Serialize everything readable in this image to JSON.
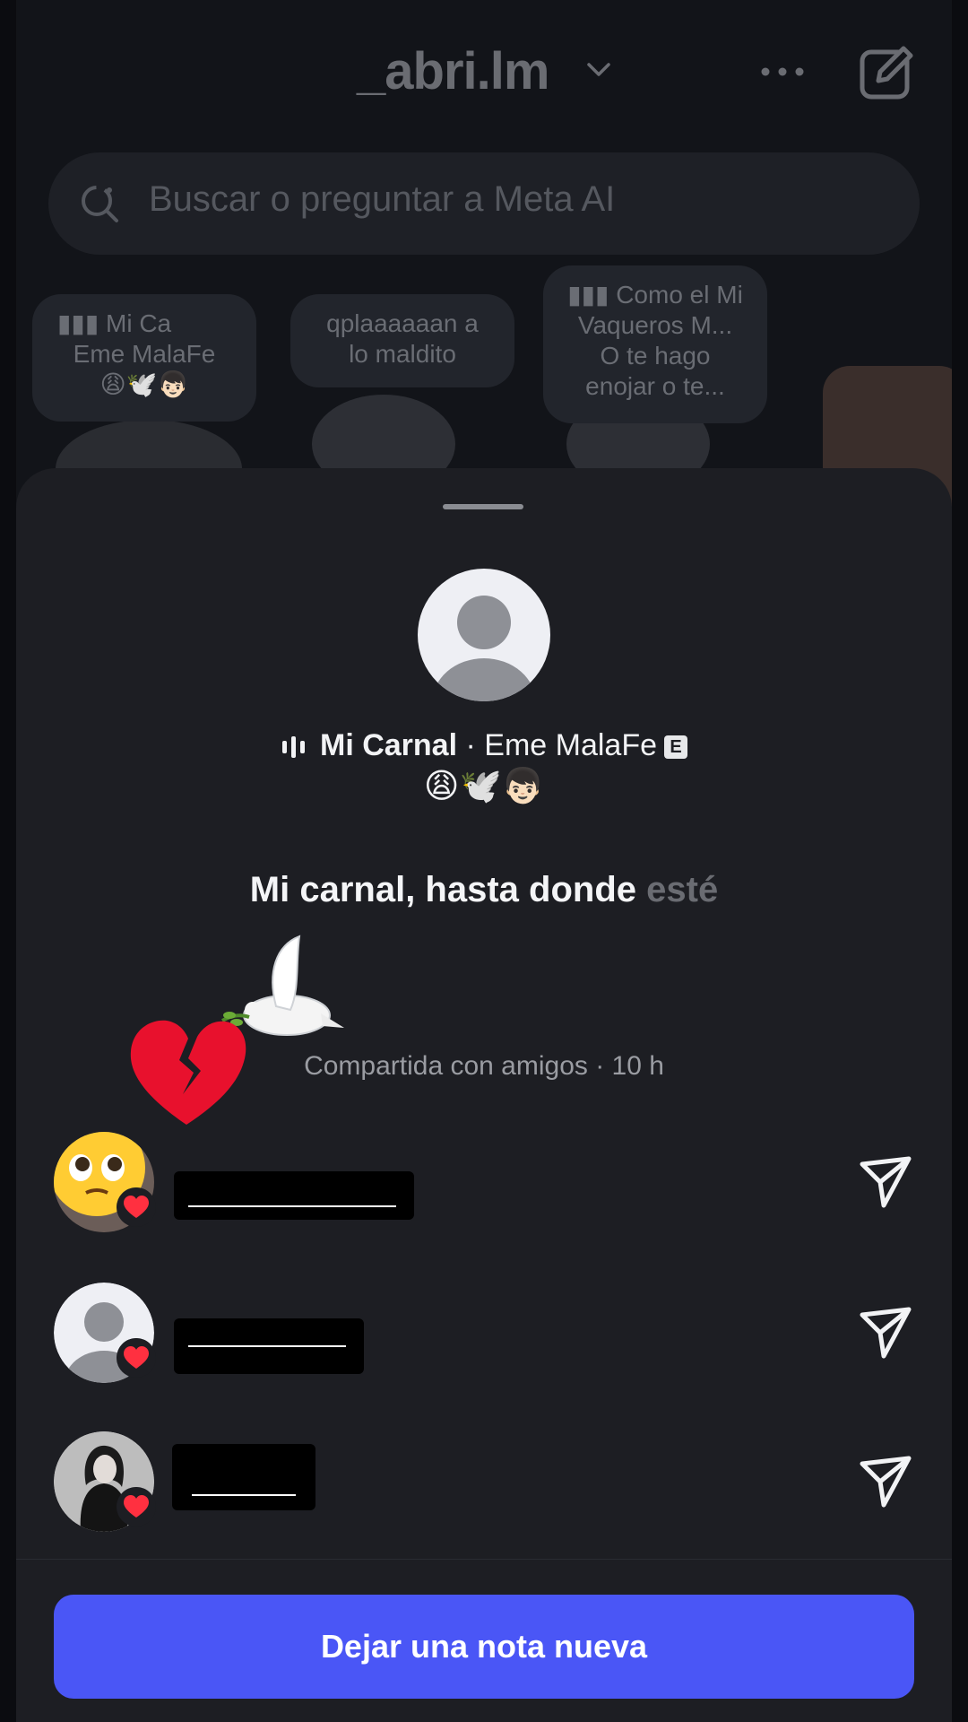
{
  "header": {
    "username": "_abri.lm"
  },
  "search": {
    "placeholder": "Buscar o preguntar a Meta AI"
  },
  "notes": [
    {
      "line1": "Mi Ca",
      "line2": "Eme MalaFe"
    },
    {
      "line1": "qplaaaaaan a",
      "line2": "lo maldito"
    },
    {
      "line1": "Como el Mi",
      "line2": "Vaqueros M...",
      "line3": "O te hago",
      "line4": "enojar o te..."
    }
  ],
  "sheet": {
    "song_title": "Mi Carnal",
    "song_separator": " · ",
    "song_artist": "Eme MalaFe",
    "explicit_badge": "E",
    "emojis": "😩🕊️👦🏻",
    "note_text_main": "Mi carnal, hasta donde ",
    "note_text_faded": "esté",
    "shared_info": "Compartida con amigos · 10 h",
    "action_button": "Dejar una nota nueva"
  },
  "reactions": [
    {
      "reaction": "heart"
    },
    {
      "reaction": "heart"
    },
    {
      "reaction": "heart"
    }
  ],
  "colors": {
    "accent": "#4a56f6",
    "heart": "#ff3040",
    "background": "#121419",
    "sheet": "#1d1e23"
  }
}
